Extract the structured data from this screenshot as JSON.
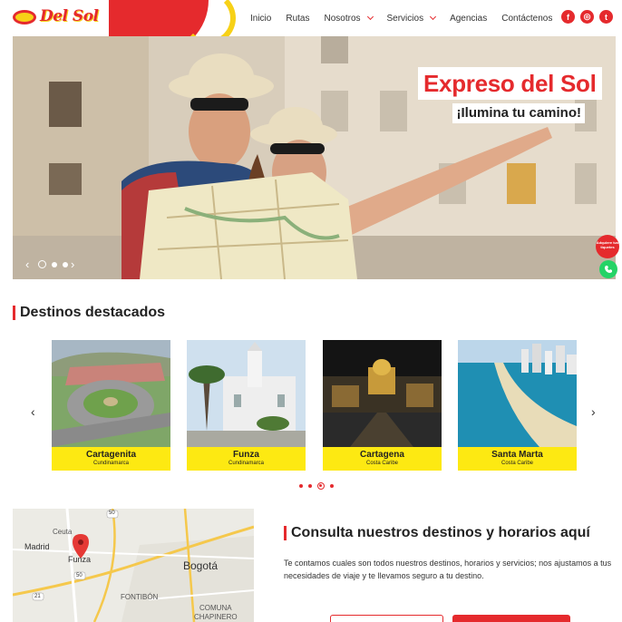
{
  "header": {
    "nav": [
      {
        "label": "Inicio",
        "has_dropdown": false
      },
      {
        "label": "Rutas",
        "has_dropdown": false
      },
      {
        "label": "Nosotros",
        "has_dropdown": true
      },
      {
        "label": "Servicios",
        "has_dropdown": true
      },
      {
        "label": "Agencias",
        "has_dropdown": false
      },
      {
        "label": "Contáctenos",
        "has_dropdown": false
      }
    ],
    "social_icons": [
      "facebook-icon",
      "instagram-icon",
      "twitter-icon"
    ]
  },
  "hero": {
    "title": "Expreso del Sol",
    "subtitle": "¡Ilumina tu camino!",
    "slides_count": 3,
    "active_slide": 1,
    "ticket_badge": "Adquiere tus tiquetes"
  },
  "destinos": {
    "title": "Destinos destacados",
    "cards": [
      {
        "name": "Cartagenita",
        "region": "Cundinamarca"
      },
      {
        "name": "Funza",
        "region": "Cundinamarca"
      },
      {
        "name": "Cartagena",
        "region": "Costa Caribe"
      },
      {
        "name": "Santa Marta",
        "region": "Costa Caribe"
      }
    ],
    "pages_count": 4,
    "active_page": 3
  },
  "map": {
    "labels": {
      "ceuta": "Ceuta",
      "madrid": "Madrid",
      "funza": "Funza",
      "bogota": "Bogotá",
      "fontibon": "FONTIBÓN",
      "comuna": "COMUNA",
      "chapinero": "CHAPINERO",
      "r50": "50",
      "r21": "21",
      "r50b": "50"
    }
  },
  "consulta": {
    "title": "Consulta nuestros destinos y horarios aquí",
    "text": "Te contamos cuales son todos nuestros destinos, horarios y servicios; nos ajustamos a tus necesidades de viaje y te llevamos seguro a tu destino."
  },
  "colors": {
    "brand_red": "#e52a2d",
    "brand_yellow": "#fde912",
    "whatsapp": "#25d366"
  }
}
